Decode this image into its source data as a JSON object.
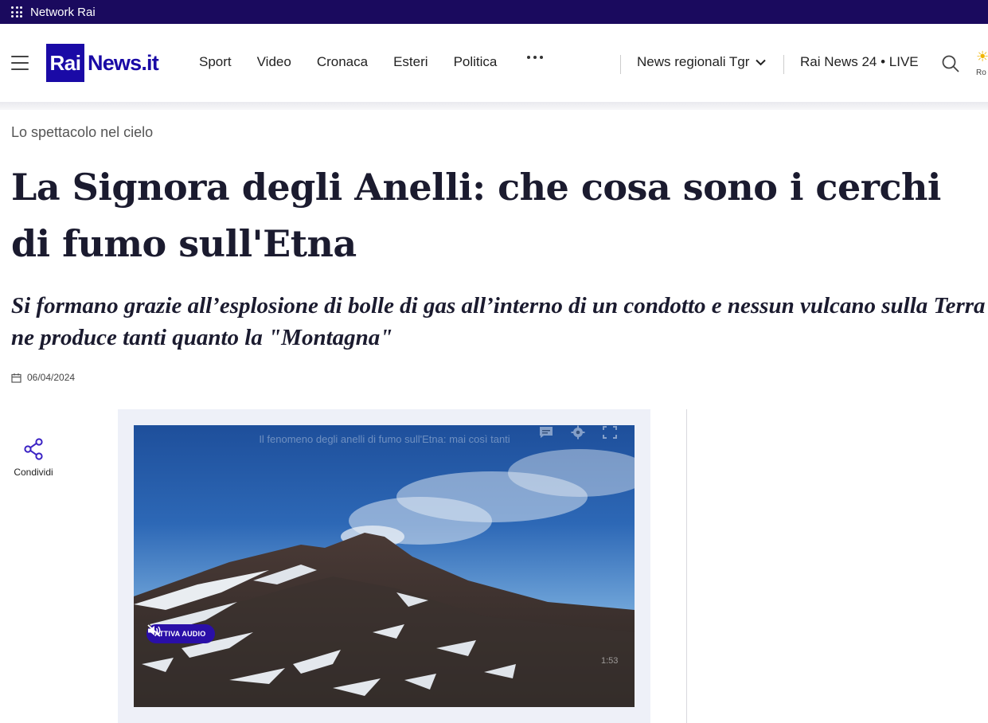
{
  "network_bar": {
    "label": "Network Rai"
  },
  "header": {
    "logo_box": "Rai",
    "logo_text": "News.it",
    "nav": [
      "Sport",
      "Video",
      "Cronaca",
      "Esteri",
      "Politica"
    ],
    "regional": "News regionali Tgr",
    "live": "Rai News 24 • LIVE",
    "weather_city": "Ro"
  },
  "article": {
    "kicker": "Lo spettacolo nel cielo",
    "title": "La Signora degli Anelli: che cosa sono i cerchi di fumo sull'Etna",
    "subtitle": "Si formano grazie all’esplosione di bolle di gas all’interno di un condotto e nessun vulcano sulla Terra ne produce tanti quanto la \"Montagna\"",
    "date": "06/04/2024"
  },
  "share": {
    "label": "Condividi"
  },
  "video": {
    "caption": "Il fenomeno degli anelli di fumo sull'Etna: mai così tanti",
    "audio_button": "ATTIVA AUDIO",
    "duration": "1:53"
  },
  "colors": {
    "brand": "#1a0aa6",
    "network_bar": "#1a0a5e",
    "audio_button": "#2a0fa8"
  }
}
